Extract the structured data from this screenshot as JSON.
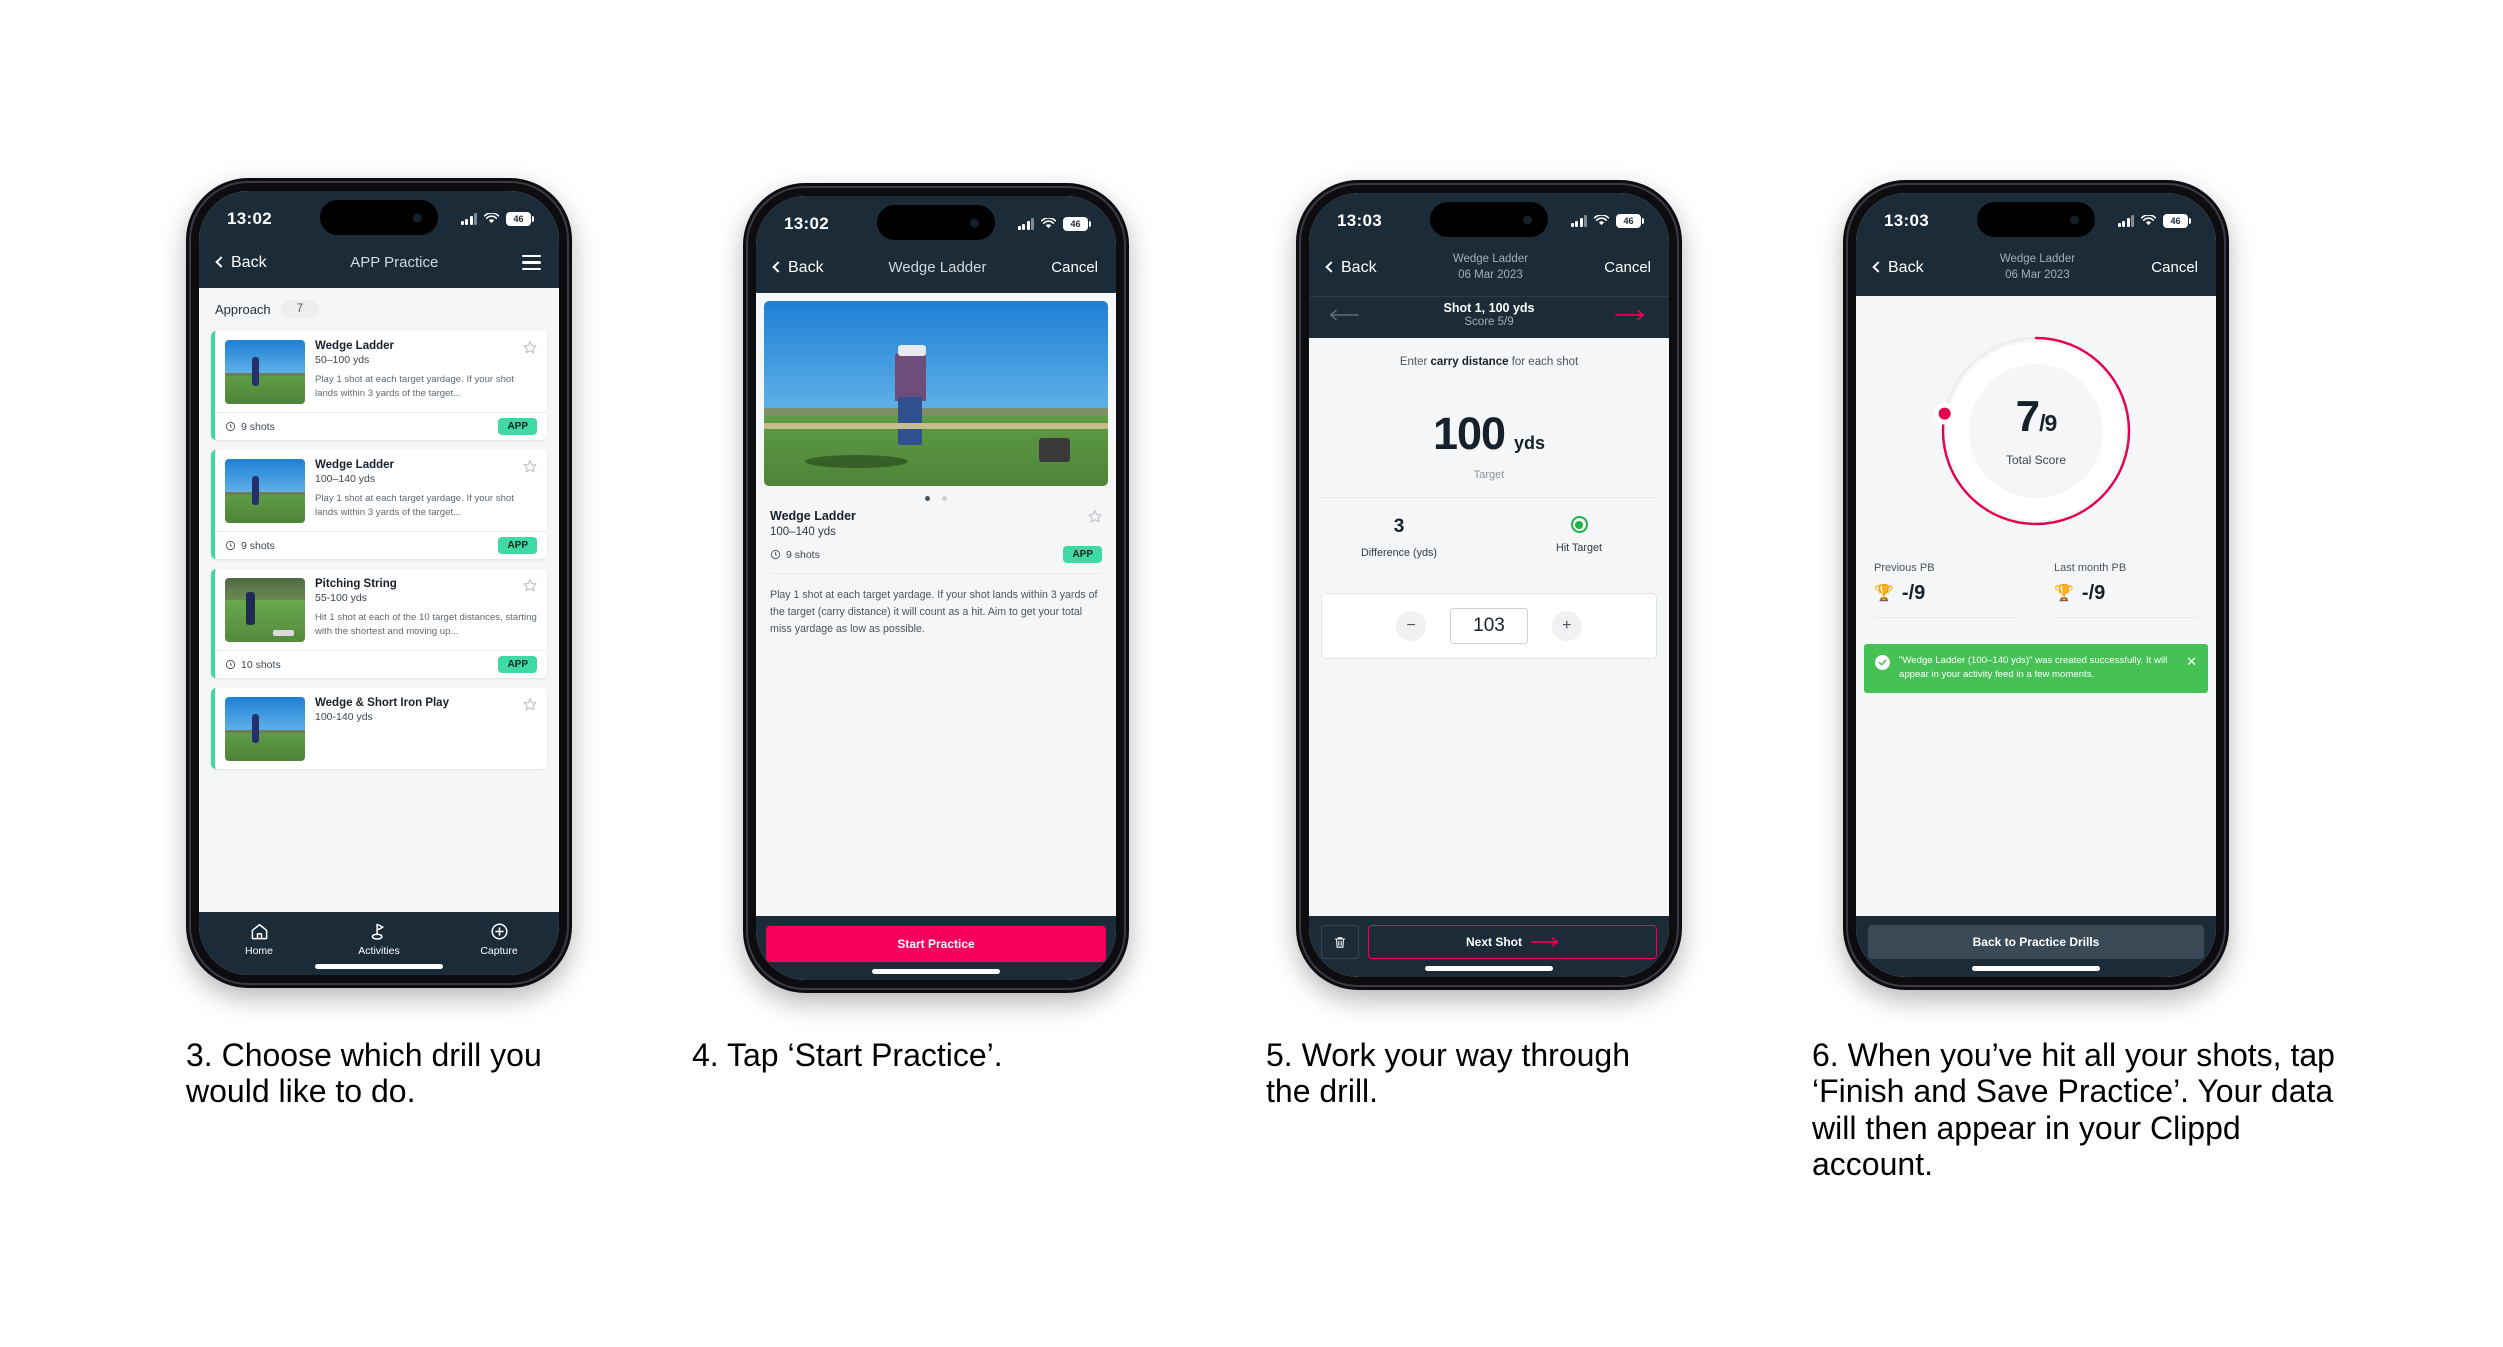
{
  "phones": {
    "p1": {
      "status": {
        "time": "13:02",
        "battery": "46"
      },
      "nav": {
        "back": "Back",
        "title": "APP Practice",
        "menu_icon": "hamburger-icon"
      },
      "section": {
        "label": "Approach",
        "count": "7"
      },
      "cards": [
        {
          "title": "Wedge Ladder",
          "sub": "50–100 yds",
          "desc": "Play 1 shot at each target yardage. If your shot lands within 3 yards of the target...",
          "shots": "9 shots",
          "tag": "APP"
        },
        {
          "title": "Wedge Ladder",
          "sub": "100–140 yds",
          "desc": "Play 1 shot at each target yardage. If your shot lands within 3 yards of the target...",
          "shots": "9 shots",
          "tag": "APP"
        },
        {
          "title": "Pitching String",
          "sub": "55-100 yds",
          "desc": "Hit 1 shot at each of the 10 target distances, starting with the shortest and moving up...",
          "shots": "10 shots",
          "tag": "APP"
        },
        {
          "title": "Wedge & Short Iron Play",
          "sub": "100-140 yds",
          "desc": "",
          "shots": "",
          "tag": ""
        }
      ],
      "tabs": [
        {
          "label": "Home",
          "icon": "home-icon"
        },
        {
          "label": "Activities",
          "icon": "golf-flag-icon"
        },
        {
          "label": "Capture",
          "icon": "plus-circle-icon"
        }
      ]
    },
    "p2": {
      "status": {
        "time": "13:02",
        "battery": "46"
      },
      "nav": {
        "back": "Back",
        "title": "Wedge Ladder",
        "cancel": "Cancel"
      },
      "detail": {
        "title": "Wedge Ladder",
        "sub": "100–140 yds",
        "shots": "9 shots",
        "tag": "APP",
        "desc": "Play 1 shot at each target yardage. If your shot lands within 3 yards of the target (carry distance) it will count as a hit. Aim to get your total miss yardage as low as possible."
      },
      "cta": "Start Practice"
    },
    "p3": {
      "status": {
        "time": "13:03",
        "battery": "46"
      },
      "nav": {
        "back": "Back",
        "title": "Wedge Ladder",
        "subtitle": "06 Mar 2023",
        "cancel": "Cancel"
      },
      "shotbar": {
        "title": "Shot 1, 100 yds",
        "sub": "Score 5/9"
      },
      "hint_pre": "Enter ",
      "hint_bold": "carry distance",
      "hint_post": " for each shot",
      "target_value": "100",
      "target_unit": "yds",
      "target_label": "Target",
      "stats": [
        {
          "value": "3",
          "label": "Difference (yds)"
        },
        {
          "value": "",
          "label": "Hit Target"
        }
      ],
      "stepper": {
        "minus": "−",
        "value": "103",
        "plus": "+"
      },
      "footer": {
        "delete_icon": "trash-icon",
        "next": "Next Shot"
      }
    },
    "p4": {
      "status": {
        "time": "13:03",
        "battery": "46"
      },
      "nav": {
        "back": "Back",
        "title": "Wedge Ladder",
        "subtitle": "06 Mar 2023",
        "cancel": "Cancel"
      },
      "score": {
        "value": "7",
        "total": "/9",
        "label": "Total Score",
        "ring_color": "#e4004f",
        "ring_track": "#eeeeee",
        "percent": 78
      },
      "pbs": [
        {
          "label": "Previous PB",
          "value": "-/9",
          "icon": "trophy-icon"
        },
        {
          "label": "Last month PB",
          "value": "-/9",
          "icon": "trophy-icon"
        }
      ],
      "toast": {
        "text": "\"Wedge Ladder (100–140 yds)\" was created successfully. It will appear in your activity feed in a few moments.",
        "check_icon": "check-circle-icon",
        "close_icon": "close-icon",
        "color": "#45c155"
      },
      "footer_button": "Back to Practice Drills"
    }
  },
  "captions": [
    "3. Choose which drill you would like to do.",
    "4. Tap ‘Start Practice’.",
    "5. Work your way through the drill.",
    "6. When you’ve hit all your shots, tap ‘Finish and Save Practice’. Your data will then appear in your Clippd account."
  ]
}
